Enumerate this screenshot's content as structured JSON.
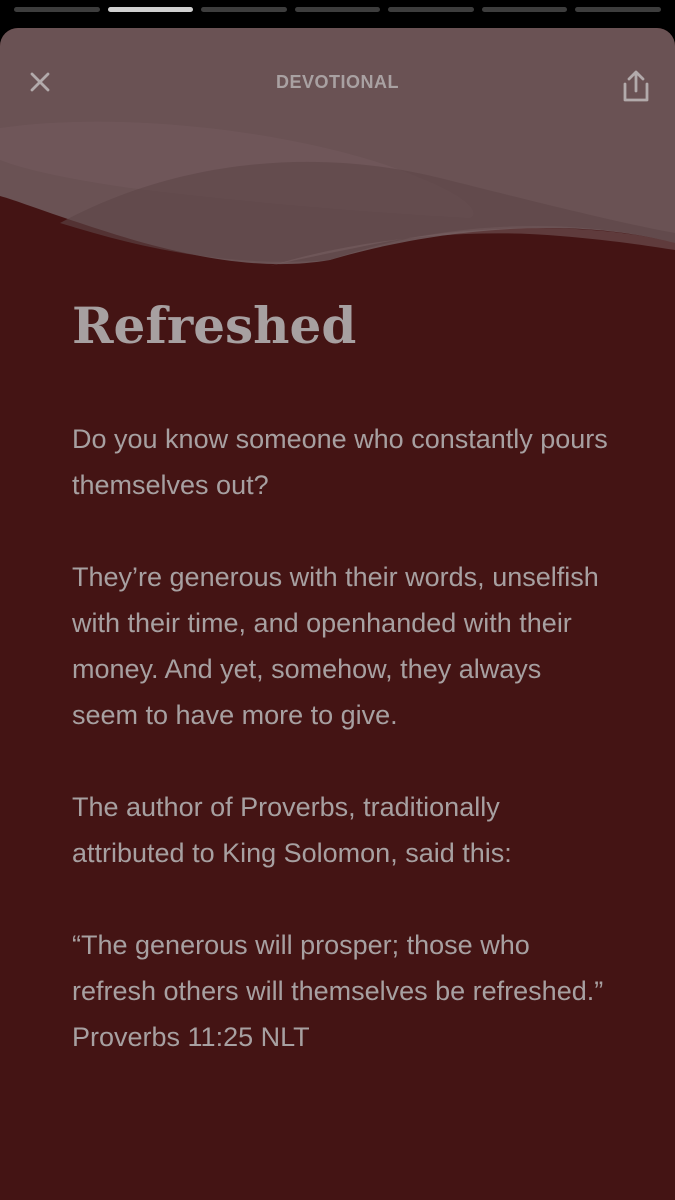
{
  "story_progress": {
    "segments": 7,
    "active_index": 1
  },
  "header": {
    "title": "DEVOTIONAL",
    "close_icon": "close-icon",
    "share_icon": "share-icon"
  },
  "devotional": {
    "title": "Refreshed",
    "paragraphs": [
      "Do you know someone who constantly pours themselves out?",
      "They’re generous with their words, unselfish with their time, and openhanded with their money. And yet, somehow, they always seem to have more to give.",
      "The author of Proverbs, traditionally attributed to King Solomon, said this:",
      "“The generous will prosper; those who refresh others will themselves be refreshed.”"
    ],
    "reference": "Proverbs 11:25 NLT"
  },
  "colors": {
    "background": "#000000",
    "card": "#441414",
    "header_wave": "#6a5254",
    "text": "#a7a0a1"
  }
}
